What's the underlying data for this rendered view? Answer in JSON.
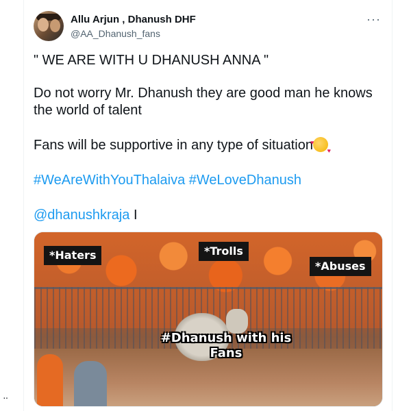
{
  "tweet": {
    "author_name": "Allu Arjun , Dhanush DHF",
    "author_handle": "@AA_Dhanush_fans",
    "more_icon": "···",
    "line1": "\" WE ARE WITH U DHANUSH ANNA \"",
    "line2": "Do not worry Mr. Dhanush they are good man he knows the world of talent",
    "line3": "Fans will be supportive in any type of situation",
    "line3_emoji": "smiling-face-with-hearts-icon",
    "hashtag1": "#WeAreWithYouThalaiva",
    "hashtag2": "#WeLoveDhanush",
    "mention": "@dhanushkraja",
    "mention_suffix": " I"
  },
  "meme": {
    "label_haters": "*Haters",
    "label_trolls": "*Trolls",
    "label_abuses": "*Abuses",
    "caption": "#Dhanush with his Fans"
  },
  "left_rail": {
    "dots": "··"
  },
  "colors": {
    "link": "#1d9bf0",
    "text": "#0f1419",
    "secondary": "#536471"
  }
}
